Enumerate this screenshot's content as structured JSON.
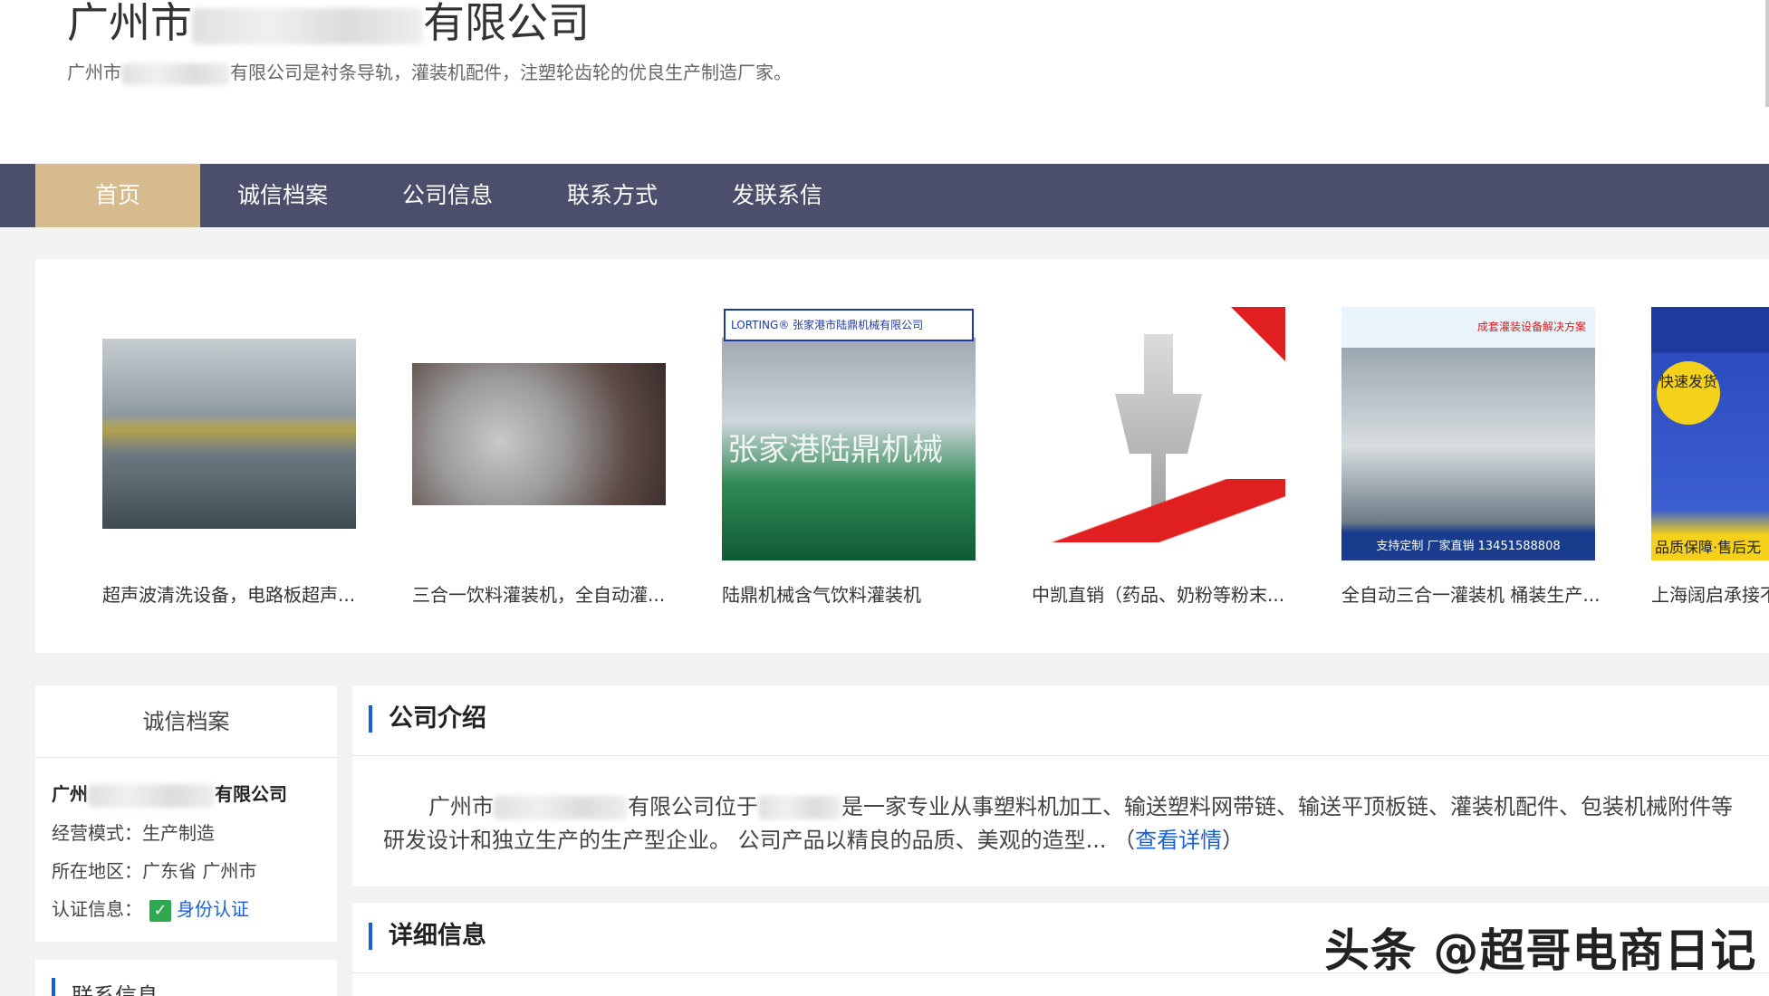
{
  "header": {
    "title_prefix": "广州市",
    "title_suffix": "有限公司",
    "desc_prefix": "广州市",
    "desc_suffix": "有限公司是衬条导轨，灌装机配件，注塑轮齿轮的优良生产制造厂家。"
  },
  "nav": {
    "items": [
      {
        "label": "首页"
      },
      {
        "label": "诚信档案"
      },
      {
        "label": "公司信息"
      },
      {
        "label": "联系方式"
      },
      {
        "label": "发联系信"
      }
    ]
  },
  "products": [
    {
      "caption": "超声波清洗设备，电路板超声..."
    },
    {
      "caption": "三合一饮料灌装机，全自动灌..."
    },
    {
      "caption": "陆鼎机械含气饮料灌装机",
      "banner": "LORTING® 张家港市陆鼎机械有限公司",
      "overlay": "张家港陆鼎机械"
    },
    {
      "caption": "中凯直销（药品、奶粉等粉末..."
    },
    {
      "caption": "全自动三合一灌装机 桶装生产...",
      "top": "成套灌装设备解决方案",
      "bottom": "支持定制 厂家直销 13451588808"
    },
    {
      "caption": "上海阔启承接不锈",
      "badge": "快速发货",
      "bottom": "品质保障·售后无"
    }
  ],
  "sidebar": {
    "title": "诚信档案",
    "company_prefix": "广州",
    "company_suffix": "有限公司",
    "mode_label": "经营模式：",
    "mode_value": "生产制造",
    "region_label": "所在地区：",
    "region_value": "广东省  广州市",
    "cert_label": "认证信息：",
    "cert_value": "身份认证",
    "contact_title": "联系信息"
  },
  "intro": {
    "title": "公司介绍",
    "line1_prefix": "广州市",
    "line1_mid": "有限公司位于",
    "line1_suffix": "是一家专业从事塑料机加工、输送塑料网带链、输送平顶板链、灌装机配件、包装机械附件等",
    "line2": "研发设计和独立生产的生产型企业。 公司产品以精良的品质、美观的造型... （",
    "more": "查看详情",
    "line2_end": "）"
  },
  "details": {
    "title": "详细信息"
  },
  "watermark": "头条 @超哥电商日记"
}
